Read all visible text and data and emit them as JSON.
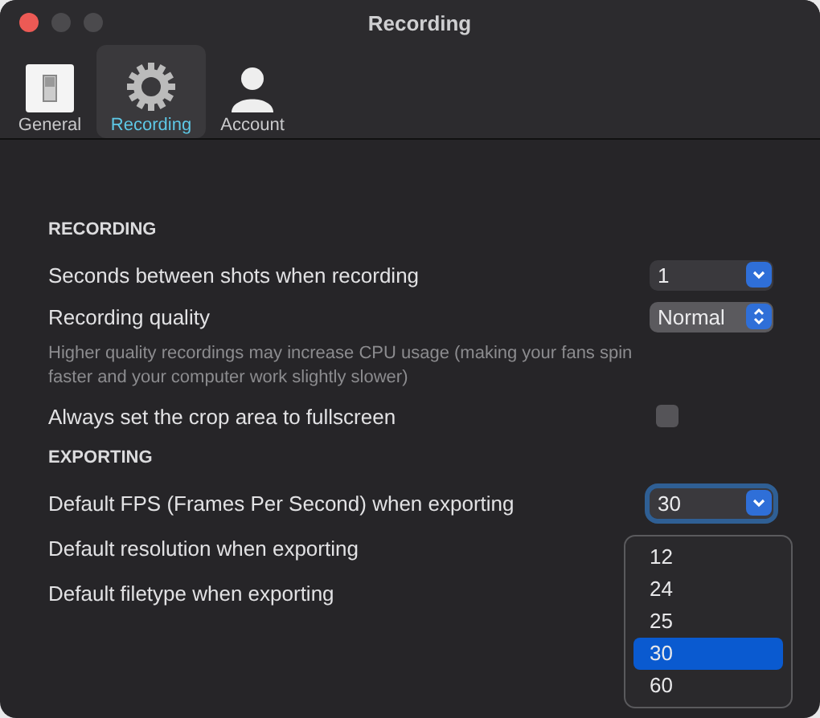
{
  "window": {
    "title": "Recording"
  },
  "tabs": [
    {
      "label": "General",
      "kind": "switch",
      "selected": false
    },
    {
      "label": "Recording",
      "kind": "gear",
      "selected": true
    },
    {
      "label": "Account",
      "kind": "person",
      "selected": false
    }
  ],
  "sections": [
    {
      "heading": "RECORDING",
      "rows": [
        {
          "kind": "select",
          "label": "Seconds between shots when recording",
          "value": "1"
        },
        {
          "kind": "stepper",
          "label": "Recording quality",
          "value": "Normal"
        },
        {
          "kind": "hint",
          "label": "Higher quality recordings may increase CPU usage (making your fans spin faster and your computer work slightly slower)"
        },
        {
          "kind": "checkbox",
          "label": "Always set the crop area to fullscreen",
          "checked": false
        }
      ]
    },
    {
      "heading": "EXPORTING",
      "rows": [
        {
          "kind": "select",
          "label": "Default FPS (Frames Per Second) when exporting",
          "value": "30",
          "focused": true
        },
        {
          "kind": "plain",
          "label": "Default resolution when exporting"
        },
        {
          "kind": "plain",
          "label": "Default filetype when exporting"
        }
      ]
    }
  ],
  "menu": {
    "options": [
      {
        "label": "12",
        "selected": false
      },
      {
        "label": "24",
        "selected": false
      },
      {
        "label": "25",
        "selected": false
      },
      {
        "label": "30",
        "selected": true
      },
      {
        "label": "60",
        "selected": false
      }
    ]
  }
}
